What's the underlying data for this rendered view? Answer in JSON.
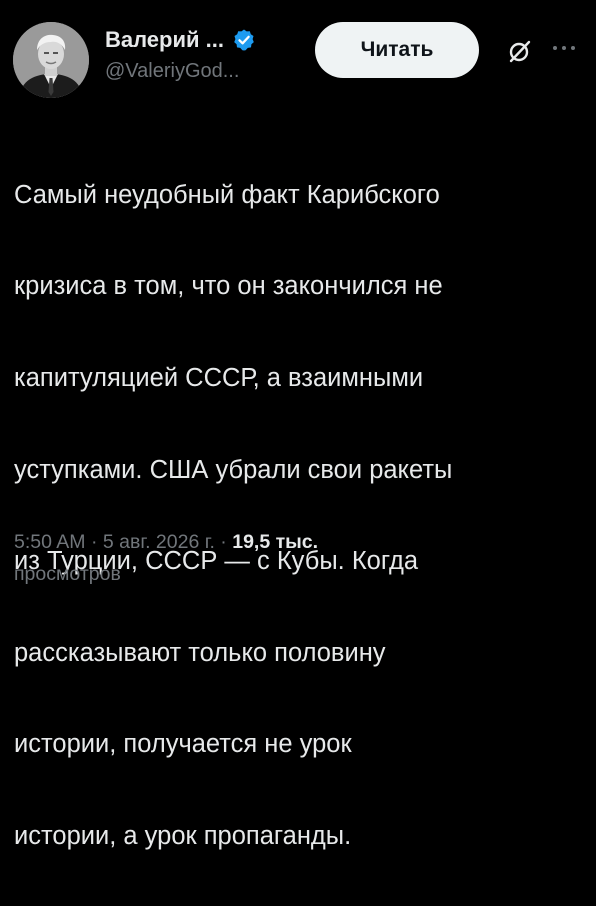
{
  "author": {
    "display_name": "Валерий ...",
    "handle": "@ValeriyGod..."
  },
  "actions": {
    "follow_label": "Читать",
    "grok_icon": "grok-slash-icon",
    "more_icon": "more-horizontal-icon"
  },
  "tweet": {
    "text_lines": [
      "Самый неудобный факт Карибского",
      "кризиса в том, что он закончился не",
      "капитуляцией СССР, а взаимными",
      "уступками. США убрали свои ракеты",
      "из Турции, СССР — с Кубы. Когда",
      "рассказывают только половину",
      "истории, получается не урок",
      "истории, а урок пропаганды."
    ]
  },
  "meta": {
    "time": "5:50 AM",
    "separator": " · ",
    "date": "5 авг. 2026 г.",
    "views_count": "19,5 тыс.",
    "views_label": "просмотров"
  },
  "colors": {
    "background": "#000000",
    "text_primary": "#e7e9ea",
    "text_secondary": "#71767b",
    "verified_blue": "#1d9bf0",
    "button_bg": "#eff3f4"
  }
}
